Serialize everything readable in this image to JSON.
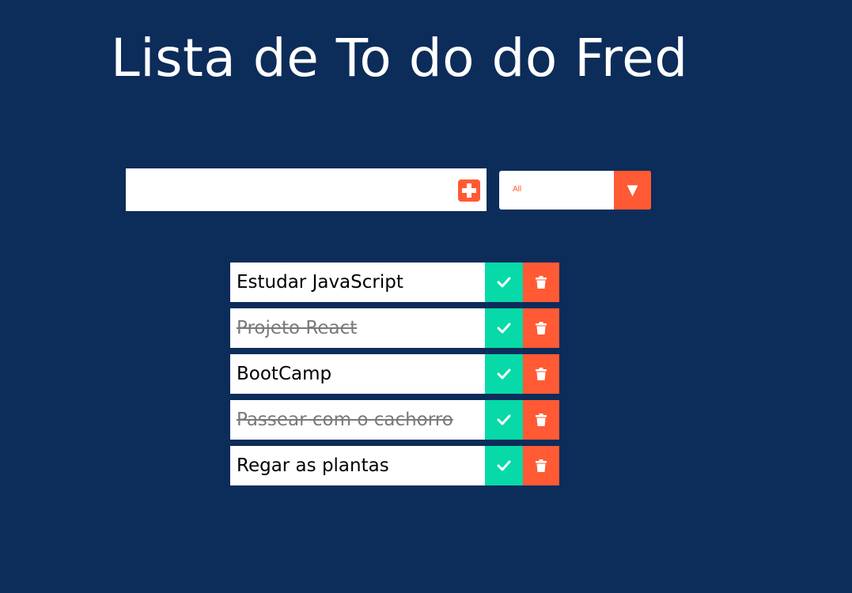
{
  "header": {
    "title": "Lista de To do do Fred"
  },
  "form": {
    "input_value": "",
    "add_icon": "plus-square-icon"
  },
  "filter": {
    "selected": "All",
    "arrow_icon": "caret-down-icon",
    "arrow_glyph": "▼"
  },
  "todos": [
    {
      "text": "Estudar JavaScript",
      "completed": false
    },
    {
      "text": "Projeto React",
      "completed": true
    },
    {
      "text": "BootCamp",
      "completed": false
    },
    {
      "text": "Passear com o cachorro",
      "completed": true
    },
    {
      "text": "Regar as plantas",
      "completed": false
    }
  ],
  "icons": {
    "complete": "check-icon",
    "delete": "trash-icon"
  },
  "colors": {
    "background": "#0c2c5a",
    "accent": "#ff5a34",
    "complete": "#08d9a8",
    "completed_text": "#7a7a7a"
  }
}
